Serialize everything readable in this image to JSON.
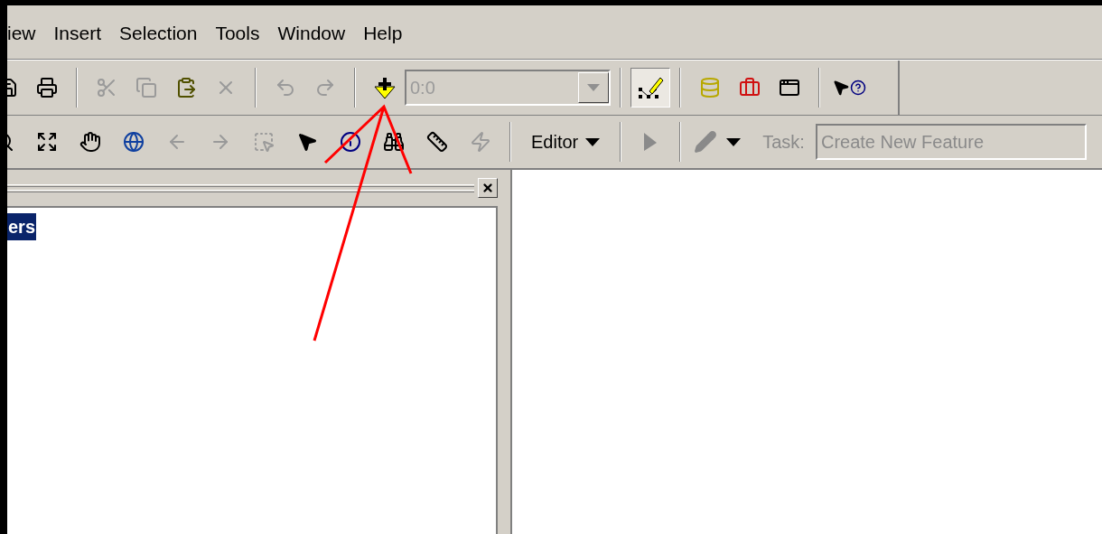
{
  "menu": [
    "iew",
    "Insert",
    "Selection",
    "Tools",
    "Window",
    "Help"
  ],
  "toolbar_standard": [
    {
      "kind": "save",
      "disabled": false
    },
    {
      "kind": "print",
      "disabled": false
    },
    {
      "kind": "separator"
    },
    {
      "kind": "cut",
      "disabled": true
    },
    {
      "kind": "copy",
      "disabled": true
    },
    {
      "kind": "paste",
      "disabled": false
    },
    {
      "kind": "delete",
      "disabled": true
    },
    {
      "kind": "separator"
    },
    {
      "kind": "undo",
      "disabled": true
    },
    {
      "kind": "redo",
      "disabled": true
    },
    {
      "kind": "separator"
    },
    {
      "kind": "add-data",
      "disabled": false
    },
    {
      "kind": "scale",
      "disabled": true,
      "value": "0:0"
    },
    {
      "kind": "separator"
    },
    {
      "kind": "editor-toolbar",
      "disabled": false,
      "pressed": true
    },
    {
      "kind": "separator"
    },
    {
      "kind": "catalog",
      "disabled": false
    },
    {
      "kind": "toolbox",
      "disabled": false
    },
    {
      "kind": "command",
      "disabled": false
    },
    {
      "kind": "separator"
    },
    {
      "kind": "whats-this",
      "disabled": false
    }
  ],
  "toolbar_tools": [
    {
      "kind": "zoom-in",
      "disabled": false
    },
    {
      "kind": "full-extent",
      "disabled": false
    },
    {
      "kind": "pan",
      "disabled": false
    },
    {
      "kind": "globe",
      "disabled": false
    },
    {
      "kind": "back",
      "disabled": true
    },
    {
      "kind": "forward",
      "disabled": true
    },
    {
      "kind": "select-elements",
      "disabled": true
    },
    {
      "kind": "pointer",
      "disabled": false
    },
    {
      "kind": "identify",
      "disabled": false
    },
    {
      "kind": "find",
      "disabled": false
    },
    {
      "kind": "measure",
      "disabled": false
    },
    {
      "kind": "hyperlink",
      "disabled": true
    }
  ],
  "editor_toolbar": {
    "menu_label": "Editor",
    "sketch_disabled": true,
    "pencil_disabled": true,
    "task_label": "Task:",
    "task_value": "Create New Feature"
  },
  "table_of_contents": {
    "item": {
      "label": "ers",
      "selected": true
    }
  }
}
